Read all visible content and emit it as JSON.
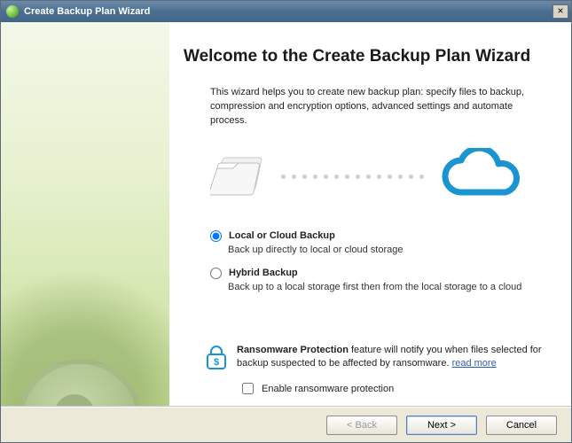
{
  "window": {
    "title": "Create Backup Plan Wizard"
  },
  "heading": "Welcome to the Create Backup Plan Wizard",
  "intro": "This wizard helps you to create new backup plan: specify files to backup, compression and encryption options, advanced settings and automate process.",
  "options": [
    {
      "id": "local_cloud",
      "label": "Local or Cloud Backup",
      "desc": "Back up directly to local or cloud storage",
      "selected": true
    },
    {
      "id": "hybrid",
      "label": "Hybrid Backup",
      "desc": "Back up to a local storage first then from the local storage to a cloud",
      "selected": false
    }
  ],
  "ransomware": {
    "title": "Ransomware Protection",
    "body_after_title": " feature will notify you when files selected for backup suspected to be affected by ransomware. ",
    "link": "read more",
    "checkbox_label": "Enable ransomware protection",
    "checked": false
  },
  "buttons": {
    "back": "< Back",
    "next": "Next >",
    "cancel": "Cancel"
  }
}
